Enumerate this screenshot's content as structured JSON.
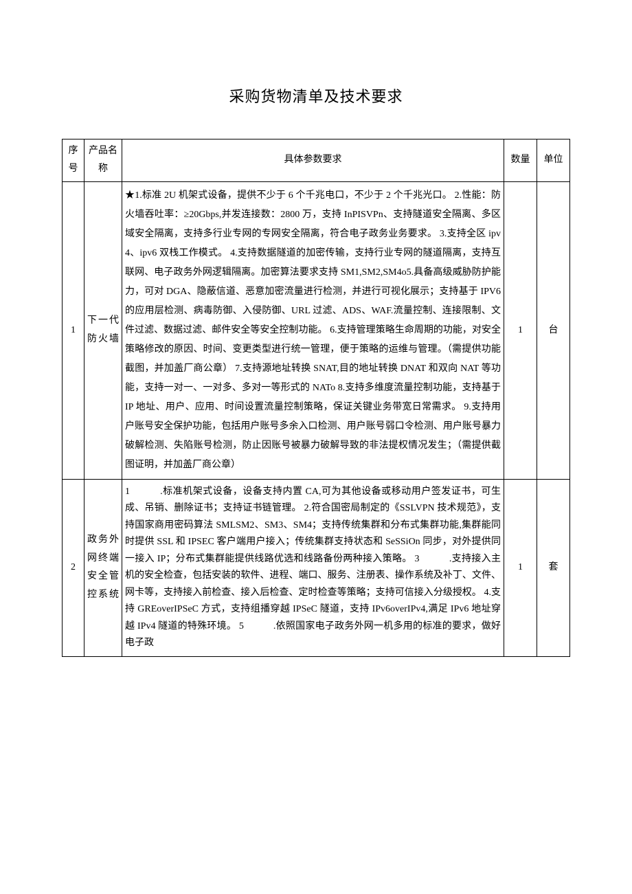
{
  "title": "采购货物清单及技术要求",
  "headers": {
    "seq": "序号",
    "name": "产品名称",
    "spec": "具体参数要求",
    "qty": "数量",
    "unit": "单位"
  },
  "rows": [
    {
      "seq": "1",
      "name": "下一代防火墙",
      "spec": "★1.标准 2U 机架式设备，提供不少于 6 个千兆电口，不少于 2 个千兆光口。\n2.性能：防火墙吞吐率：≥20Gbps,并发连接数：2800 万，支持 InPISVPn、支持隧道安全隔离、多区域安全隔离，支持多行业专网的专网安全隔离，符合电子政务业务要求。\n3.支持全区 ipv4、ipv6 双栈工作模式。\n4.支持数据隧道的加密传输，支持行业专网的隧道隔离，支持互联网、电子政务外网逻辑隔离。加密算法要求支持 SM1,SM2,SM4o5.具备高级威胁防护能力，可对 DGA、隐蔽信道、恶意加密流量进行检测，并进行可视化展示；支持基于 IPV6 的应用层检测、病毒防御、入侵防御、URL 过滤、ADS、WAF.流量控制、连接限制、文件过滤、数据过滤、邮件安全等安全控制功能。\n6.支持管理策略生命周期的功能，对安全策略修改的原因、时间、变更类型进行统一管理，便于策略的运维与管理。（需提供功能截图，并加盖厂商公章）\n7.支持源地址转换 SNAT,目的地址转换 DNAT 和双向 NAT 等功能，支持一对一、一对多、多对一等形式的 NATo\n8.支持多维度流量控制功能，支持基于 IP 地址、用户、应用、时间设置流量控制策略，保证关键业务带宽日常需求。\n9.支持用户账号安全保护功能，包括用户账号多余入口检测、用户账号弱口令检测、用户账号暴力破解检测、失陷账号检测，防止因账号被暴力破解导致的非法提权情况发生；（需提供截图证明，并加盖厂商公章）",
      "qty": "1",
      "unit": "台"
    },
    {
      "seq": "2",
      "name": "政务外网终端安全管控系统",
      "spec": "1　　　.标准机架式设备，设备支持内置 CA,可为其他设备或移动用户签发证书，可生成、吊销、删除证书；支持证书链管理。\n2.符合国密局制定的《SSLVPN 技术规范》，支持国家商用密码算法 SMLSM2、SM3、SM4；支持传统集群和分布式集群功能,集群能同时提供 SSL 和 IPSEC 客户端用户接入；传统集群支持状态和 SeSSiOn 同步，对外提供同一接入 IP；分布式集群能提供线路优选和线路备份两种接入策略。\n3　　　.支持接入主机的安全检查，包括安装的软件、进程、端口、服务、注册表、操作系统及补丁、文件、网卡等，支持接入前检查、接入后检查、定时检查等策略；支持可信接入分级授权。\n4.支持 GREoverIPSeC 方式，支持组播穿越 IPSeC 隧道，支持 IPv6overIPv4,满足 IPv6 地址穿越 IPv4 隧道的特殊环境。\n5　　　.依照国家电子政务外网一机多用的标准的要求，做好电子政",
      "qty": "1",
      "unit": "套"
    }
  ]
}
